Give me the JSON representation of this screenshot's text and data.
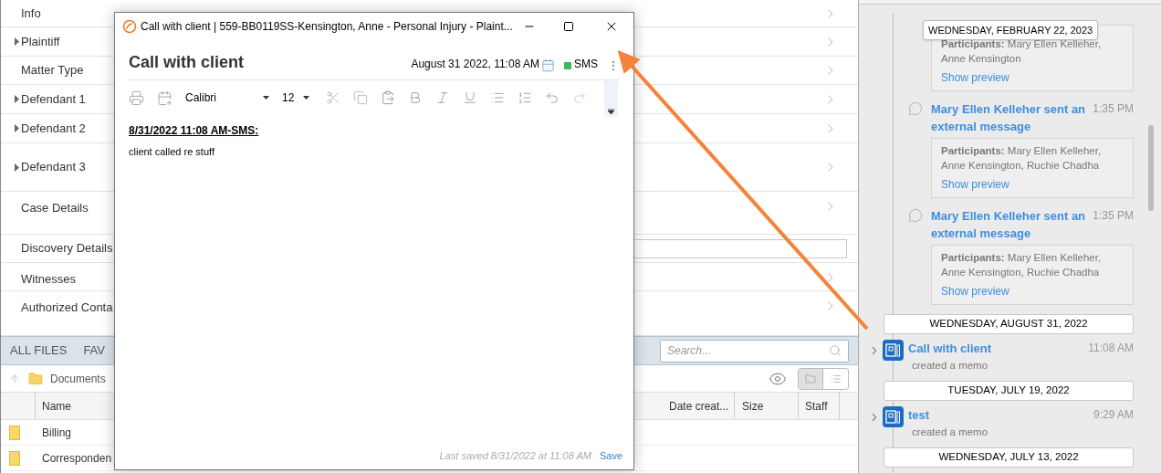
{
  "sections": [
    {
      "label": "Info",
      "kind": "plain"
    },
    {
      "label": "Plaintiff",
      "kind": "expandable"
    },
    {
      "label": "Matter Type",
      "kind": "plain"
    },
    {
      "label": "Defendant 1",
      "kind": "expandable"
    },
    {
      "label": "Defendant 2",
      "kind": "expandable"
    },
    {
      "label": "Defendant 3",
      "kind": "expandable"
    },
    {
      "label": "Case Details",
      "kind": "plain"
    },
    {
      "label": "Discovery Details",
      "kind": "field"
    },
    {
      "label": "Witnesses",
      "kind": "plain"
    },
    {
      "label": "Authorized Conta",
      "kind": "plain"
    }
  ],
  "files": {
    "tabs": [
      "ALL FILES",
      "FAV"
    ],
    "search": {
      "placeholder": "Search..."
    },
    "path": "Documents",
    "columns": [
      "Name",
      "Date creat...",
      "Size",
      "Staff"
    ],
    "rows": [
      "Billing",
      "Corresponden"
    ]
  },
  "dialog": {
    "title": "Call with client | 559-BB0119SS-Kensington, Anne - Personal Injury - Plaint...",
    "heading": "Call with client",
    "datetime": "August 31 2022, 11:08 AM",
    "channel": {
      "label": "SMS",
      "color": "#3cb95a"
    },
    "font": "Calibri",
    "size": "12",
    "body_heading": "8/31/2022 11:08 AM-SMS:",
    "body_text": "client called re stuff",
    "last_saved": "Last saved 8/31/2022 at 11:08 AM",
    "save": "Save"
  },
  "timeline": {
    "tooltip": "WEDNESDAY, FEBRUARY 22, 2023",
    "items": [
      {
        "kind": "card",
        "participants": "**Participants:** Mary Ellen Kelleher, Anne Kensington",
        "link": "Show preview"
      },
      {
        "kind": "message",
        "title": "Mary Ellen Kelleher sent an external message",
        "time": "1:35 PM",
        "participants": "**Participants:** Mary Ellen Kelleher, Anne Kensington, Ruchie Chadha",
        "link": "Show preview"
      },
      {
        "kind": "message",
        "title": "Mary Ellen Kelleher sent an external message",
        "time": "1:35 PM",
        "participants": "**Participants:** Mary Ellen Kelleher, Anne Kensington, Ruchie Chadha",
        "link": "Show preview"
      },
      {
        "kind": "date",
        "label": "WEDNESDAY, AUGUST 31, 2022"
      },
      {
        "kind": "memo",
        "title": "Call with client",
        "time": "11:08 AM",
        "subtitle": "created a memo"
      },
      {
        "kind": "date",
        "label": "TUESDAY, JULY 19, 2022"
      },
      {
        "kind": "memo",
        "title": "test",
        "time": "9:29 AM",
        "subtitle": "created a memo"
      },
      {
        "kind": "date",
        "label": "WEDNESDAY, JULY 13, 2022"
      }
    ]
  }
}
